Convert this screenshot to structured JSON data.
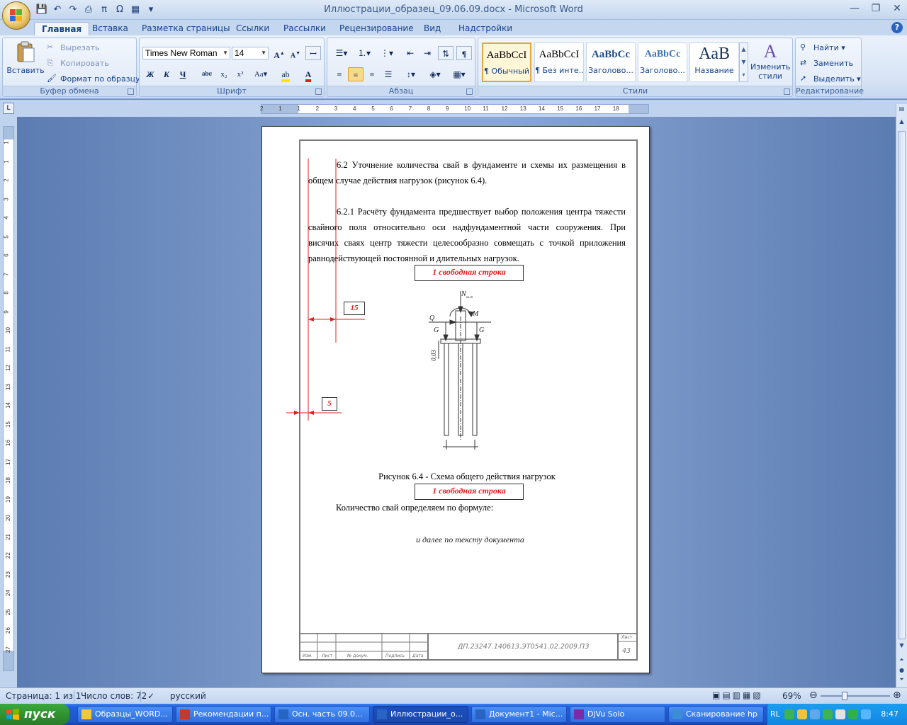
{
  "window": {
    "title": "Иллюстрации_образец_09.06.09.docx - Microsoft Word"
  },
  "ribbon_tabs": [
    "Главная",
    "Вставка",
    "Разметка страницы",
    "Ссылки",
    "Рассылки",
    "Рецензирование",
    "Вид",
    "Надстройки"
  ],
  "clipboard": {
    "paste": "Вставить",
    "cut": "Вырезать",
    "copy": "Копировать",
    "format_painter": "Формат по образцу",
    "label": "Буфер обмена"
  },
  "font": {
    "name": "Times New Roman",
    "size": "14",
    "label": "Шрифт"
  },
  "paragraph": {
    "label": "Абзац"
  },
  "styles": {
    "items": [
      {
        "sample": "AaBbCcI",
        "name": "¶ Обычный"
      },
      {
        "sample": "AaBbCcI",
        "name": "¶ Без инте..."
      },
      {
        "sample": "AaBbCc",
        "name": "Заголово..."
      },
      {
        "sample": "AaBbCc",
        "name": "Заголово..."
      },
      {
        "sample": "AaB",
        "name": "Название"
      }
    ],
    "change": "Изменить стили",
    "label": "Стили"
  },
  "editing": {
    "find": "Найти",
    "replace": "Заменить",
    "select": "Выделить",
    "label": "Редактирование"
  },
  "document": {
    "heading_line1": "6.2 Уточнение количества свай в фундаменте и схемы их размещения в",
    "heading_line2": "общем случае действия нагрузок (рисунок 6.4).",
    "para_line1": "6.2.1 Расчёту фундамента предшествует выбор положения центра тяжести",
    "para_line2": "свайного поля относительно оси надфундаментной части сооружения. При",
    "para_line3": "висячих сваях центр тяжести целесообразно совмещать с точкой приложения",
    "para_line4": "равнодействующей постоянной и длительных нагрузок.",
    "free_line_1": "1 свободная строка",
    "free_line_2": "1 свободная строка",
    "dim_15": "15",
    "dim_5": "5",
    "fig_N": "N",
    "fig_N_sub": "ол.т",
    "fig_M": "M",
    "fig_Q": "Q",
    "fig_G_left": "G",
    "fig_G_right": "G",
    "fig_dim": "0,03",
    "caption": "Рисунок 6.4 - Схема общего действия нагрузок",
    "formula_intro": "Количество свай определяем по формуле:",
    "continuation": "и далее по тексту документа",
    "stamp_code": "ДП.23247.140613.ЭТ0541.02.2009.ПЗ",
    "stamp_sheet_label": "Лист",
    "stamp_sheet_num": "43",
    "stamp_cols": [
      "Изм.",
      "Лист",
      "№ докум.",
      "Подпись",
      "Дата"
    ]
  },
  "statusbar": {
    "page": "Страница: 1 из 1",
    "words": "Число слов: 72",
    "language": "русский",
    "zoom": "69%"
  },
  "ruler": {
    "h_numbers": [
      "2",
      "1",
      "1",
      "2",
      "3",
      "4",
      "5",
      "6",
      "7",
      "8",
      "9",
      "10",
      "11",
      "12",
      "13",
      "14",
      "15",
      "16",
      "17",
      "18"
    ],
    "v_numbers": [
      "1",
      "1",
      "2",
      "3",
      "4",
      "5",
      "6",
      "7",
      "8",
      "9",
      "10",
      "11",
      "12",
      "13",
      "14",
      "15",
      "16",
      "17",
      "18",
      "19",
      "20",
      "21",
      "22",
      "23",
      "24",
      "25",
      "26",
      "27"
    ]
  },
  "taskbar": {
    "start": "пуск",
    "tasks": [
      {
        "label": "Образцы_WORD...",
        "active": false
      },
      {
        "label": "Рекомендации п...",
        "active": false
      },
      {
        "label": "Осн. часть 09.0...",
        "active": false
      },
      {
        "label": "Иллюстрации_о...",
        "active": true
      },
      {
        "label": "Документ1 - Mic...",
        "active": false
      },
      {
        "label": "DjVu Solo",
        "active": false
      },
      {
        "label": "Сканирование hp",
        "active": false
      }
    ],
    "lang": "RL",
    "clock": "8:47"
  }
}
